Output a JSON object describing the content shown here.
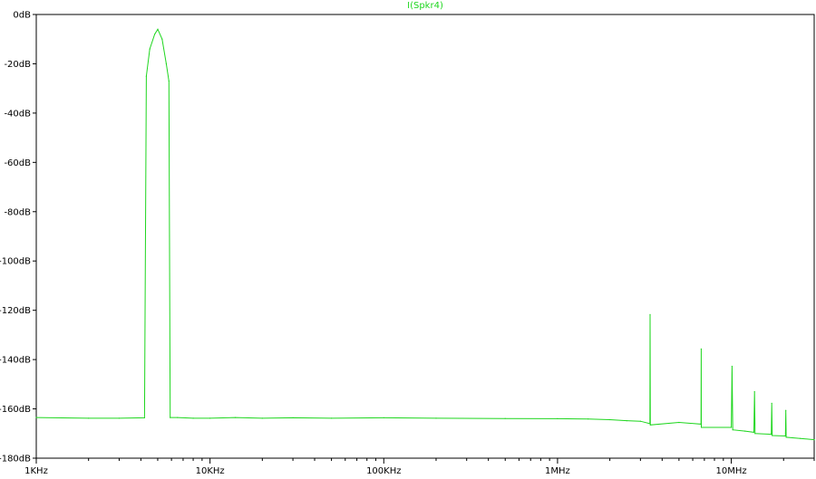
{
  "window": {
    "background": "#ffffff"
  },
  "chart_data": {
    "type": "line",
    "title": "I(Spkr4)",
    "title_color": "#1ed61e",
    "xlabel": "",
    "ylabel": "",
    "xscale": "log",
    "xlim": [
      1000,
      30000000
    ],
    "ylim": [
      -180,
      0
    ],
    "grid": false,
    "x_ticks": [
      {
        "value": 1000,
        "label": "1KHz"
      },
      {
        "value": 10000,
        "label": "10KHz"
      },
      {
        "value": 100000,
        "label": "100KHz"
      },
      {
        "value": 1000000,
        "label": "1MHz"
      },
      {
        "value": 10000000,
        "label": "10MHz"
      }
    ],
    "y_ticks": [
      {
        "value": 0,
        "label": "0dB"
      },
      {
        "value": -20,
        "label": "-20dB"
      },
      {
        "value": -40,
        "label": "-40dB"
      },
      {
        "value": -60,
        "label": "-60dB"
      },
      {
        "value": -80,
        "label": "-80dB"
      },
      {
        "value": -100,
        "label": "-100dB"
      },
      {
        "value": -120,
        "label": "-120dB"
      },
      {
        "value": -140,
        "label": "-140dB"
      },
      {
        "value": -160,
        "label": "-160dB"
      },
      {
        "value": -180,
        "label": "-180dB"
      }
    ],
    "series": [
      {
        "color": "#1ed61e",
        "points": [
          [
            1000,
            -163.5
          ],
          [
            2000,
            -163.8
          ],
          [
            3000,
            -163.8
          ],
          [
            4200,
            -163.6
          ],
          [
            4300,
            -25
          ],
          [
            4500,
            -14
          ],
          [
            4800,
            -8
          ],
          [
            5000,
            -6
          ],
          [
            5300,
            -10
          ],
          [
            5600,
            -20
          ],
          [
            5800,
            -27
          ],
          [
            5900,
            -163.5
          ],
          [
            6500,
            -163.5
          ],
          [
            8000,
            -163.8
          ],
          [
            10000,
            -163.8
          ],
          [
            14000,
            -163.5
          ],
          [
            20000,
            -163.8
          ],
          [
            30000,
            -163.6
          ],
          [
            50000,
            -163.8
          ],
          [
            100000,
            -163.6
          ],
          [
            200000,
            -163.8
          ],
          [
            500000,
            -163.9
          ],
          [
            1000000,
            -164.0
          ],
          [
            1500000,
            -164.1
          ],
          [
            2000000,
            -164.4
          ],
          [
            2500000,
            -164.8
          ],
          [
            3000000,
            -165.0
          ],
          [
            3400000,
            -166.0
          ],
          [
            3410000,
            -121.7
          ],
          [
            3420000,
            -166.5
          ],
          [
            5000000,
            -165.5
          ],
          [
            6700000,
            -166.2
          ],
          [
            6710000,
            -135.7
          ],
          [
            6720000,
            -167.5
          ],
          [
            10000000,
            -167.5
          ],
          [
            10100000,
            -142.7
          ],
          [
            10200000,
            -168.5
          ],
          [
            12000000,
            -169.0
          ],
          [
            13500000,
            -169.5
          ],
          [
            13600000,
            -153.0
          ],
          [
            13700000,
            -170.0
          ],
          [
            17000000,
            -170.3
          ],
          [
            17100000,
            -157.7
          ],
          [
            17200000,
            -170.8
          ],
          [
            20500000,
            -171.0
          ],
          [
            20600000,
            -160.6
          ],
          [
            20700000,
            -171.5
          ],
          [
            25000000,
            -172.0
          ],
          [
            30000000,
            -172.5
          ]
        ]
      }
    ]
  }
}
